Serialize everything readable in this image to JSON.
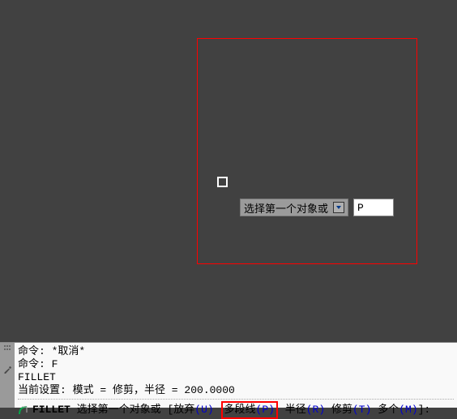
{
  "tooltip": {
    "text": "选择第一个对象或",
    "input_value": "P"
  },
  "command_history": {
    "line1": "命令: *取消*",
    "line2": "命令: F",
    "line3": "FILLET",
    "line4": "当前设置: 模式 = 修剪，半径 = 200.0000"
  },
  "command_prompt": {
    "command": "FILLET",
    "prompt_text": "选择第一个对象或",
    "bracket_open": "[",
    "options": {
      "undo_label": "放弃",
      "undo_key": "(U)",
      "polyline_label": "多段线",
      "polyline_key": "(P)",
      "radius_label": "半径",
      "radius_key": "(R)",
      "trim_label": "修剪",
      "trim_key": "(T)",
      "multiple_label": "多个",
      "multiple_key": "(M)"
    },
    "bracket_close": "]:"
  },
  "icons": {
    "grip": "grip-icon",
    "wrench": "wrench-icon",
    "dropdown": "dropdown-icon",
    "arc": "fillet-arc-icon"
  }
}
